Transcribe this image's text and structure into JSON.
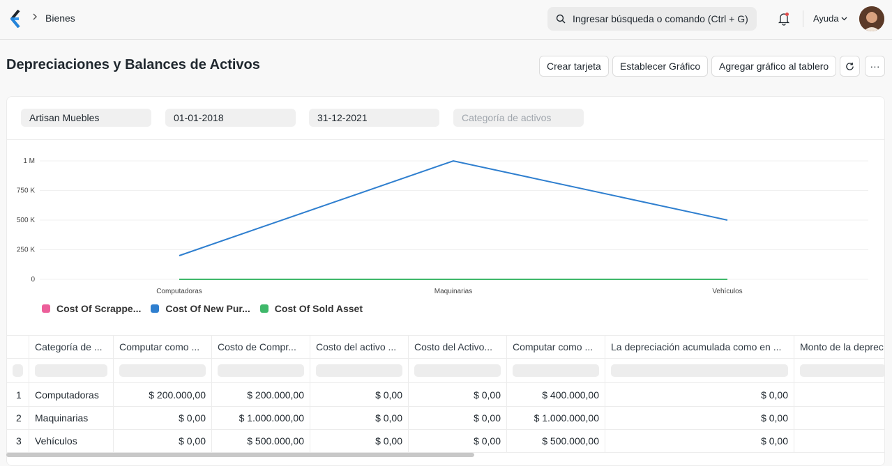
{
  "navbar": {
    "breadcrumb": "Bienes",
    "search_placeholder": "Ingresar búsqueda o comando (Ctrl + G)",
    "help_label": "Ayuda"
  },
  "page": {
    "title": "Depreciaciones y Balances de Activos",
    "buttons": {
      "create_card": "Crear tarjeta",
      "set_chart": "Establecer Gráfico",
      "add_to_dashboard": "Agregar gráfico al tablero",
      "more": "···"
    }
  },
  "filters": {
    "company": "Artisan Muebles",
    "from_date": "01-01-2018",
    "to_date": "31-12-2021",
    "asset_category_placeholder": "Categoría de activos"
  },
  "chart_data": {
    "type": "line",
    "categories": [
      "Computadoras",
      "Maquinarias",
      "Vehículos"
    ],
    "y_ticks": [
      "0",
      "250 K",
      "500 K",
      "750 K",
      "1 M"
    ],
    "ylim": [
      0,
      1000000
    ],
    "series": [
      {
        "name": "Cost Of Scrappe...",
        "color": "#ec5f9a",
        "values": [
          0,
          0,
          0
        ]
      },
      {
        "name": "Cost Of New Pur...",
        "color": "#2f7fcf",
        "values": [
          200000,
          1000000,
          500000
        ]
      },
      {
        "name": "Cost Of Sold Asset",
        "color": "#3fb86a",
        "values": [
          0,
          0,
          0
        ]
      }
    ]
  },
  "table": {
    "columns": [
      "Categoría de ...",
      "Computar como ...",
      "Costo de Compr...",
      "Costo del activo ...",
      "Costo del Activo...",
      "Computar como ...",
      "La depreciación acumulada como en ...",
      "Monto de la deprec"
    ],
    "rows": [
      {
        "index": "1",
        "cells": [
          "Computadoras",
          "$ 200.000,00",
          "$ 200.000,00",
          "$ 0,00",
          "$ 0,00",
          "$ 400.000,00",
          "$ 0,00",
          ""
        ]
      },
      {
        "index": "2",
        "cells": [
          "Maquinarias",
          "$ 0,00",
          "$ 1.000.000,00",
          "$ 0,00",
          "$ 0,00",
          "$ 1.000.000,00",
          "$ 0,00",
          ""
        ]
      },
      {
        "index": "3",
        "cells": [
          "Vehículos",
          "$ 0,00",
          "$ 500.000,00",
          "$ 0,00",
          "$ 0,00",
          "$ 500.000,00",
          "$ 0,00",
          ""
        ]
      }
    ]
  }
}
